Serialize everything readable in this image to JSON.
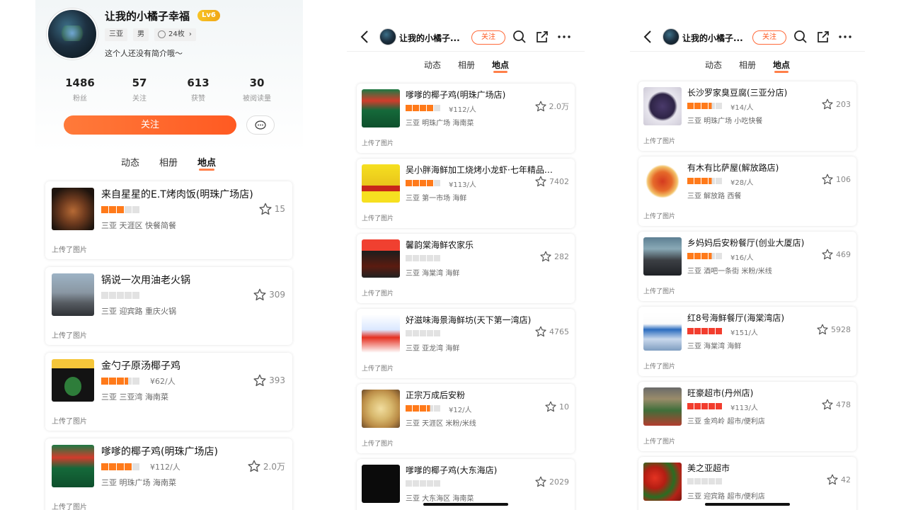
{
  "profile": {
    "name": "让我的小橘子幸福",
    "level": "Lv6",
    "tags": [
      "三亚",
      "男",
      "24枚"
    ],
    "bio": "这个人还没有简介哦～",
    "stats": [
      {
        "num": "1486",
        "label": "粉丝"
      },
      {
        "num": "57",
        "label": "关注"
      },
      {
        "num": "613",
        "label": "获赞"
      },
      {
        "num": "30",
        "label": "被阅读量"
      }
    ],
    "follow_label": "关注"
  },
  "nav": {
    "name": "让我的小橘子...",
    "follow_label": "关注"
  },
  "tabs": [
    "动态",
    "相册",
    "地点"
  ],
  "upload_label": "上传了图片",
  "colors": {
    "accent": "#ff5a22",
    "star": "#ff7a1a",
    "star_red": "#f23d2e"
  },
  "panel1_places": [
    {
      "name": "来自星星的E.T烤肉饭(明珠广场店)",
      "stars": 3,
      "price": "",
      "meta": "三亚 天涯区 快餐简餐",
      "favs": "15",
      "thumb": "bbq"
    },
    {
      "name": "锅说一次用油老火锅",
      "stars": 0,
      "price": "",
      "meta": "三亚 迎宾路 重庆火锅",
      "favs": "309",
      "thumb": "street"
    },
    {
      "name": "金勺子原汤椰子鸡",
      "stars": 3.5,
      "price": "¥62/人",
      "meta": "三亚 三亚湾 海南菜",
      "favs": "393",
      "thumb": "chicken"
    },
    {
      "name": "嗲嗲的椰子鸡(明珠广场店)",
      "stars": 4,
      "price": "¥112/人",
      "meta": "三亚 明珠广场 海南菜",
      "favs": "2.0万",
      "thumb": "coco"
    }
  ],
  "panel2_places": [
    {
      "name": "嗲嗲的椰子鸡(明珠广场店)",
      "stars": 4,
      "price": "¥112/人",
      "meta": "三亚 明珠广场 海南菜",
      "favs": "2.0万",
      "thumb": "coco"
    },
    {
      "name": "吴小胖海鲜加工烧烤小龙虾·七年精品…",
      "stars": 4,
      "price": "¥113/人",
      "meta": "三亚 第一市场 海鲜",
      "favs": "7402",
      "thumb": "wu"
    },
    {
      "name": "馨韵棠海鲜农家乐",
      "stars": 0,
      "price": "",
      "meta": "三亚 海棠湾 海鲜",
      "favs": "282",
      "thumb": "xin"
    },
    {
      "name": "好滋味海景海鲜坊(天下第一湾店)",
      "stars": 0,
      "price": "",
      "meta": "三亚 亚龙湾 海鲜",
      "favs": "4765",
      "thumb": "hao"
    },
    {
      "name": "正宗万成后安粉",
      "stars": 3.5,
      "price": "¥12/人",
      "meta": "三亚 天涯区 米粉/米线",
      "favs": "10",
      "thumb": "wc"
    },
    {
      "name": "嗲嗲的椰子鸡(大东海店)",
      "stars": 0,
      "price": "",
      "meta": "三亚 大东海区 海南菜",
      "favs": "2029",
      "thumb": "black"
    }
  ],
  "panel3_places": [
    {
      "name": "长沙罗家臭豆腐(三亚分店)",
      "stars": 3.5,
      "price": "¥14/人",
      "meta": "三亚 明珠广场 小吃快餐",
      "favs": "203",
      "thumb": "tofu"
    },
    {
      "name": "有木有比萨屋(解放路店)",
      "stars": 3.5,
      "price": "¥28/人",
      "meta": "三亚 解放路 西餐",
      "favs": "106",
      "thumb": "pizza"
    },
    {
      "name": "乡妈妈后安粉餐厅(创业大厦店)",
      "stars": 3.5,
      "price": "¥16/人",
      "meta": "三亚 酒吧一条街 米粉/米线",
      "favs": "469",
      "thumb": "rice"
    },
    {
      "name": "红8号海鲜餐厅(海棠湾店)",
      "stars": 5,
      "price": "¥151/人",
      "meta": "三亚 海棠湾 海鲜",
      "favs": "5928",
      "thumb": "red8",
      "red": true
    },
    {
      "name": "旺豪超市(丹州店)",
      "stars": 5,
      "price": "¥113/人",
      "meta": "三亚 金鸡岭 超市/便利店",
      "favs": "478",
      "thumb": "wang",
      "red": true
    },
    {
      "name": "美之亚超市",
      "stars": 0,
      "price": "",
      "meta": "三亚 迎宾路 超市/便利店",
      "favs": "42",
      "thumb": "mei"
    }
  ]
}
